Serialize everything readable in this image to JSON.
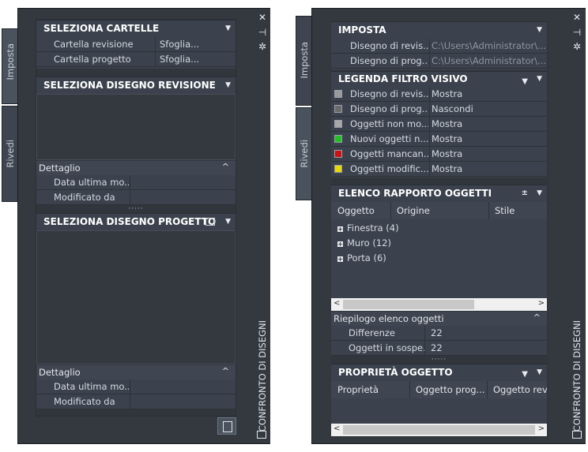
{
  "palette_title": "CONFRONTO DI DISEGNI",
  "tabs": {
    "imposta": "Imposta",
    "rivedi": "Rivedi"
  },
  "controls": {
    "close": "✕",
    "pin": "⊣",
    "settings": "✲"
  },
  "left": {
    "folders": {
      "title": "SELEZIONA CARTELLE",
      "rows": [
        {
          "label": "Cartella revisione",
          "value": "Sfoglia..."
        },
        {
          "label": "Cartella progetto",
          "value": "Sfoglia..."
        }
      ]
    },
    "revision": {
      "title": "SELEZIONA DISEGNO REVISIONE",
      "detail_title": "Dettaglio",
      "rows": [
        {
          "label": "Data ultima mo...",
          "value": ""
        },
        {
          "label": "Modificato da",
          "value": ""
        }
      ]
    },
    "project": {
      "title": "SELEZIONA DISEGNO PROGETTO",
      "detail_title": "Dettaglio",
      "rows": [
        {
          "label": "Data ultima mo...",
          "value": ""
        },
        {
          "label": "Modificato da",
          "value": ""
        }
      ]
    }
  },
  "right": {
    "setup": {
      "title": "IMPOSTA",
      "rows": [
        {
          "label": "Disegno di revis...",
          "value": "C:\\Users\\Administrator\\..."
        },
        {
          "label": "Disegno di prog...",
          "value": "C:\\Users\\Administrator\\..."
        }
      ]
    },
    "legend": {
      "title": "LEGENDA FILTRO VISIVO",
      "rows": [
        {
          "label": "Disegno di revis...",
          "value": "Mostra",
          "swatch": "#9a9a9a"
        },
        {
          "label": "Disegno di prog...",
          "value": "Nascondi",
          "swatch": "#6b6b6b"
        },
        {
          "label": "Oggetti non mo...",
          "value": "Mostra",
          "swatch": "#a8a8a8"
        },
        {
          "label": "Nuovi oggetti n...",
          "value": "Mostra",
          "swatch": "#22c022"
        },
        {
          "label": "Oggetti mancan...",
          "value": "Mostra",
          "swatch": "#d01010"
        },
        {
          "label": "Oggetti modific...",
          "value": "Mostra",
          "swatch": "#e8d800"
        }
      ]
    },
    "report": {
      "title": "ELENCO RAPPORTO OGGETTI",
      "columns": [
        "Oggetto",
        "Origine",
        "Stile"
      ],
      "items": [
        "Finestra (4)",
        "Muro (12)",
        "Porta (6)"
      ],
      "summary_title": "Riepilogo elenco oggetti",
      "summary": [
        {
          "label": "Differenze",
          "value": "22"
        },
        {
          "label": "Oggetti in sospe...",
          "value": "22"
        }
      ]
    },
    "properties": {
      "title": "PROPRIETÀ OGGETTO",
      "columns": [
        "Proprietà",
        "Oggetto prog...",
        "Oggetto revi"
      ]
    }
  }
}
